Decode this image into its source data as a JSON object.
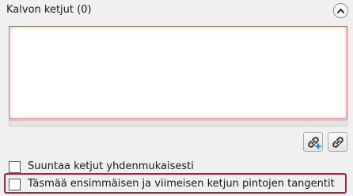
{
  "panel": {
    "title": "Kalvon ketjut (0)",
    "collapse_icon": "chevron-up-icon"
  },
  "toolbar": {
    "add_chain_icon": "link-add-icon",
    "link_icon": "link-icon"
  },
  "options": {
    "align_chains": {
      "label": "Suuntaa ketjut yhdenmukaisesti",
      "checked": false
    },
    "match_tangents": {
      "label": "Täsmää ensimmäisen ja viimeisen ketjun pintojen tangentit",
      "checked": false
    }
  },
  "colors": {
    "list_border": "#e06a6a",
    "focus_border": "#b2203c",
    "add_badge": "#1e88e5"
  }
}
